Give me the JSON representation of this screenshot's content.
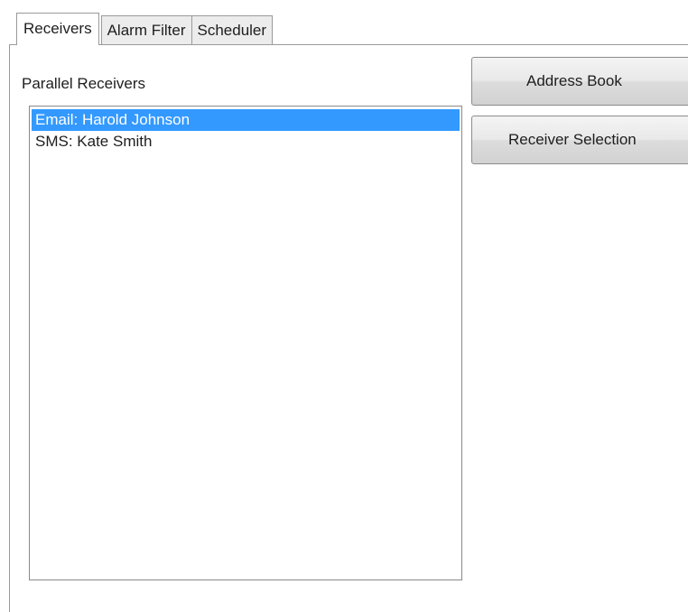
{
  "tabs": [
    {
      "label": "Receivers",
      "active": true
    },
    {
      "label": "Alarm Filter",
      "active": false
    },
    {
      "label": "Scheduler",
      "active": false
    }
  ],
  "receivers_panel": {
    "list_label": "Parallel Receivers",
    "items": [
      {
        "label": "Email: Harold Johnson",
        "selected": true
      },
      {
        "label": "SMS: Kate Smith",
        "selected": false
      }
    ]
  },
  "buttons": {
    "address_book": "Address Book",
    "receiver_selection": "Receiver Selection"
  },
  "colors": {
    "selection": "#3399ff",
    "selection_text": "#ffffff"
  }
}
